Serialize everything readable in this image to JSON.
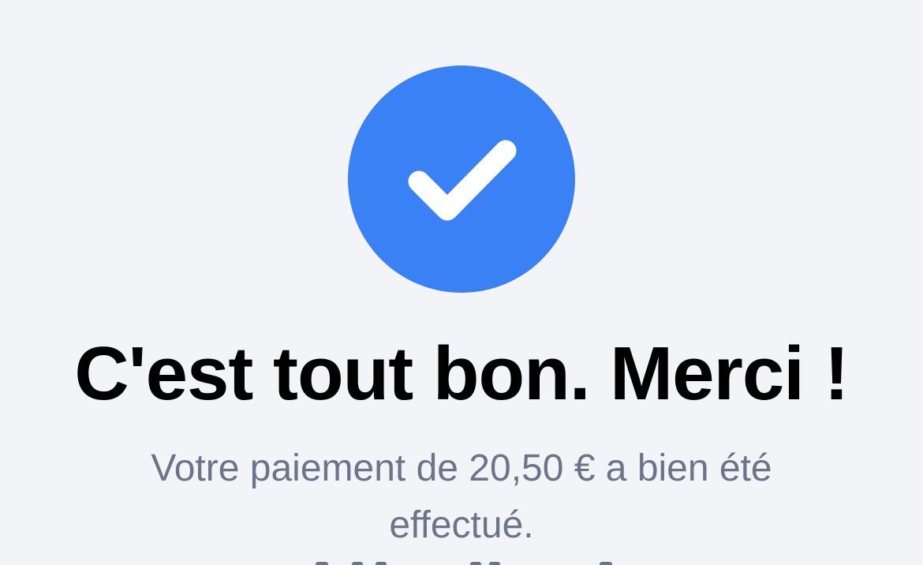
{
  "confirmation": {
    "icon": "check-circle-icon",
    "icon_color": "#3a81f5",
    "title": "C'est tout bon. Merci !",
    "message": "Votre paiement de 20,50 € a bien été effectué."
  },
  "colors": {
    "background": "#f2f4f8",
    "title": "#000000",
    "message": "#6b7488"
  }
}
